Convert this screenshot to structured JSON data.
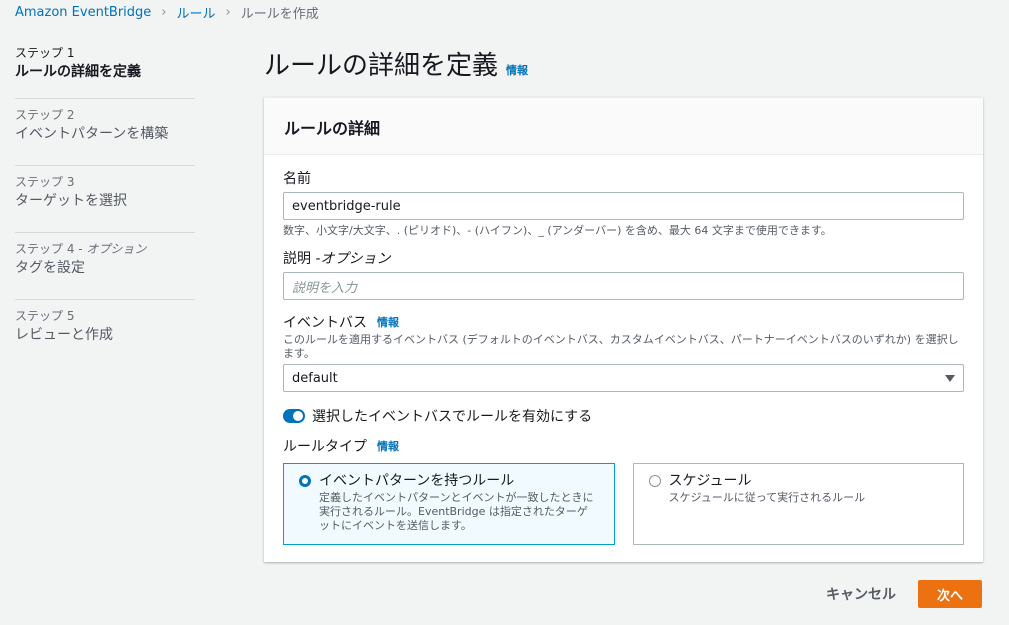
{
  "breadcrumb": [
    "Amazon EventBridge",
    "ルール",
    "ルールを作成"
  ],
  "steps": [
    {
      "num": "ステップ 1",
      "opt": "",
      "label": "ルールの詳細を定義"
    },
    {
      "num": "ステップ 2",
      "opt": "",
      "label": "イベントパターンを構築"
    },
    {
      "num": "ステップ 3",
      "opt": "",
      "label": "ターゲットを選択"
    },
    {
      "num": "ステップ 4 - ",
      "opt": "オプション",
      "label": "タグを設定"
    },
    {
      "num": "ステップ 5",
      "opt": "",
      "label": "レビューと作成"
    }
  ],
  "page": {
    "title": "ルールの詳細を定義",
    "info": "情報"
  },
  "card": {
    "title": "ルールの詳細"
  },
  "name_field": {
    "label": "名前",
    "value": "eventbridge-rule",
    "hint": "数字、小文字/大文字、. (ピリオド)、- (ハイフン)、_ (アンダーバー) を含め、最大 64 文字まで使用できます。"
  },
  "description_field": {
    "label": "説明 - ",
    "opt": "オプション",
    "placeholder": "説明を入力"
  },
  "event_bus": {
    "label": "イベントバス",
    "info": "情報",
    "hint": "このルールを適用するイベントバス (デフォルトのイベントバス、カスタムイベントバス、パートナーイベントバスのいずれか) を選択します。",
    "value": "default"
  },
  "toggle": {
    "label": "選択したイベントバスでルールを有効にする"
  },
  "rule_type": {
    "label": "ルールタイプ",
    "info": "情報",
    "options": [
      {
        "title": "イベントパターンを持つルール",
        "desc": "定義したイベントパターンとイベントが一致したときに実行されるルール。EventBridge は指定されたターゲットにイベントを送信します。"
      },
      {
        "title": "スケジュール",
        "desc": "スケジュールに従って実行されるルール"
      }
    ]
  },
  "footer": {
    "cancel": "キャンセル",
    "next": "次へ"
  },
  "colors": {
    "accent": "#0073bb",
    "primary_button": "#ec7211"
  }
}
